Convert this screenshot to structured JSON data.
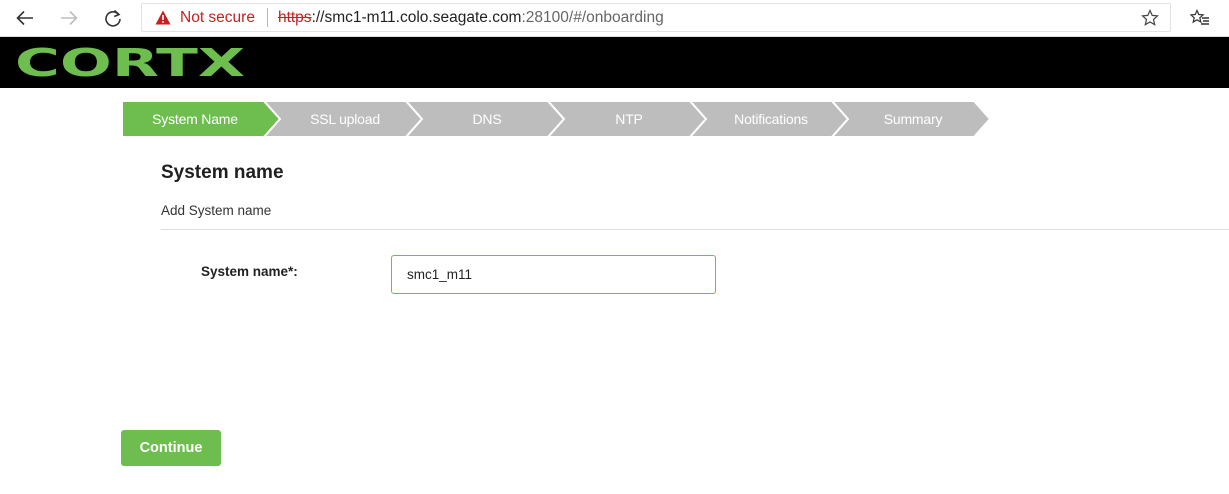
{
  "browser": {
    "not_secure_label": "Not secure",
    "url_scheme": "https",
    "url_host": "://smc1-m11.colo.seagate.com",
    "url_rest": ":28100/#/onboarding",
    "icons": [
      "back-arrow-icon",
      "forward-arrow-icon",
      "reload-icon",
      "warning-icon",
      "star-icon",
      "favorites-icon"
    ]
  },
  "header": {
    "logo_text": "CORTX",
    "logo_color": "#6ebe4f"
  },
  "wizard": {
    "active_color": "#6ebe4f",
    "inactive_color": "#bdbdbd",
    "steps": [
      {
        "label": "System Name",
        "active": true
      },
      {
        "label": "SSL upload",
        "active": false
      },
      {
        "label": "DNS",
        "active": false
      },
      {
        "label": "NTP",
        "active": false
      },
      {
        "label": "Notifications",
        "active": false
      },
      {
        "label": "Summary",
        "active": false
      }
    ]
  },
  "content": {
    "title": "System name",
    "subtitle": "Add System name",
    "field_label": "System name*:",
    "field_value": "smc1_m11"
  },
  "actions": {
    "continue_label": "Continue"
  }
}
